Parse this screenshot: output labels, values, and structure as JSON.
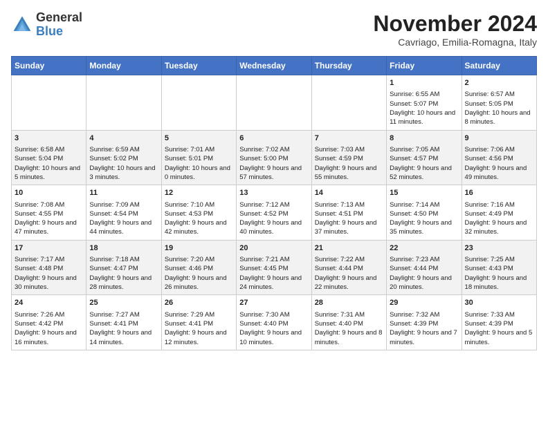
{
  "header": {
    "logo_line1": "General",
    "logo_line2": "Blue",
    "month": "November 2024",
    "location": "Cavriago, Emilia-Romagna, Italy"
  },
  "weekdays": [
    "Sunday",
    "Monday",
    "Tuesday",
    "Wednesday",
    "Thursday",
    "Friday",
    "Saturday"
  ],
  "weeks": [
    [
      {
        "day": "",
        "info": ""
      },
      {
        "day": "",
        "info": ""
      },
      {
        "day": "",
        "info": ""
      },
      {
        "day": "",
        "info": ""
      },
      {
        "day": "",
        "info": ""
      },
      {
        "day": "1",
        "info": "Sunrise: 6:55 AM\nSunset: 5:07 PM\nDaylight: 10 hours and 11 minutes."
      },
      {
        "day": "2",
        "info": "Sunrise: 6:57 AM\nSunset: 5:05 PM\nDaylight: 10 hours and 8 minutes."
      }
    ],
    [
      {
        "day": "3",
        "info": "Sunrise: 6:58 AM\nSunset: 5:04 PM\nDaylight: 10 hours and 5 minutes."
      },
      {
        "day": "4",
        "info": "Sunrise: 6:59 AM\nSunset: 5:02 PM\nDaylight: 10 hours and 3 minutes."
      },
      {
        "day": "5",
        "info": "Sunrise: 7:01 AM\nSunset: 5:01 PM\nDaylight: 10 hours and 0 minutes."
      },
      {
        "day": "6",
        "info": "Sunrise: 7:02 AM\nSunset: 5:00 PM\nDaylight: 9 hours and 57 minutes."
      },
      {
        "day": "7",
        "info": "Sunrise: 7:03 AM\nSunset: 4:59 PM\nDaylight: 9 hours and 55 minutes."
      },
      {
        "day": "8",
        "info": "Sunrise: 7:05 AM\nSunset: 4:57 PM\nDaylight: 9 hours and 52 minutes."
      },
      {
        "day": "9",
        "info": "Sunrise: 7:06 AM\nSunset: 4:56 PM\nDaylight: 9 hours and 49 minutes."
      }
    ],
    [
      {
        "day": "10",
        "info": "Sunrise: 7:08 AM\nSunset: 4:55 PM\nDaylight: 9 hours and 47 minutes."
      },
      {
        "day": "11",
        "info": "Sunrise: 7:09 AM\nSunset: 4:54 PM\nDaylight: 9 hours and 44 minutes."
      },
      {
        "day": "12",
        "info": "Sunrise: 7:10 AM\nSunset: 4:53 PM\nDaylight: 9 hours and 42 minutes."
      },
      {
        "day": "13",
        "info": "Sunrise: 7:12 AM\nSunset: 4:52 PM\nDaylight: 9 hours and 40 minutes."
      },
      {
        "day": "14",
        "info": "Sunrise: 7:13 AM\nSunset: 4:51 PM\nDaylight: 9 hours and 37 minutes."
      },
      {
        "day": "15",
        "info": "Sunrise: 7:14 AM\nSunset: 4:50 PM\nDaylight: 9 hours and 35 minutes."
      },
      {
        "day": "16",
        "info": "Sunrise: 7:16 AM\nSunset: 4:49 PM\nDaylight: 9 hours and 32 minutes."
      }
    ],
    [
      {
        "day": "17",
        "info": "Sunrise: 7:17 AM\nSunset: 4:48 PM\nDaylight: 9 hours and 30 minutes."
      },
      {
        "day": "18",
        "info": "Sunrise: 7:18 AM\nSunset: 4:47 PM\nDaylight: 9 hours and 28 minutes."
      },
      {
        "day": "19",
        "info": "Sunrise: 7:20 AM\nSunset: 4:46 PM\nDaylight: 9 hours and 26 minutes."
      },
      {
        "day": "20",
        "info": "Sunrise: 7:21 AM\nSunset: 4:45 PM\nDaylight: 9 hours and 24 minutes."
      },
      {
        "day": "21",
        "info": "Sunrise: 7:22 AM\nSunset: 4:44 PM\nDaylight: 9 hours and 22 minutes."
      },
      {
        "day": "22",
        "info": "Sunrise: 7:23 AM\nSunset: 4:44 PM\nDaylight: 9 hours and 20 minutes."
      },
      {
        "day": "23",
        "info": "Sunrise: 7:25 AM\nSunset: 4:43 PM\nDaylight: 9 hours and 18 minutes."
      }
    ],
    [
      {
        "day": "24",
        "info": "Sunrise: 7:26 AM\nSunset: 4:42 PM\nDaylight: 9 hours and 16 minutes."
      },
      {
        "day": "25",
        "info": "Sunrise: 7:27 AM\nSunset: 4:41 PM\nDaylight: 9 hours and 14 minutes."
      },
      {
        "day": "26",
        "info": "Sunrise: 7:29 AM\nSunset: 4:41 PM\nDaylight: 9 hours and 12 minutes."
      },
      {
        "day": "27",
        "info": "Sunrise: 7:30 AM\nSunset: 4:40 PM\nDaylight: 9 hours and 10 minutes."
      },
      {
        "day": "28",
        "info": "Sunrise: 7:31 AM\nSunset: 4:40 PM\nDaylight: 9 hours and 8 minutes."
      },
      {
        "day": "29",
        "info": "Sunrise: 7:32 AM\nSunset: 4:39 PM\nDaylight: 9 hours and 7 minutes."
      },
      {
        "day": "30",
        "info": "Sunrise: 7:33 AM\nSunset: 4:39 PM\nDaylight: 9 hours and 5 minutes."
      }
    ]
  ]
}
